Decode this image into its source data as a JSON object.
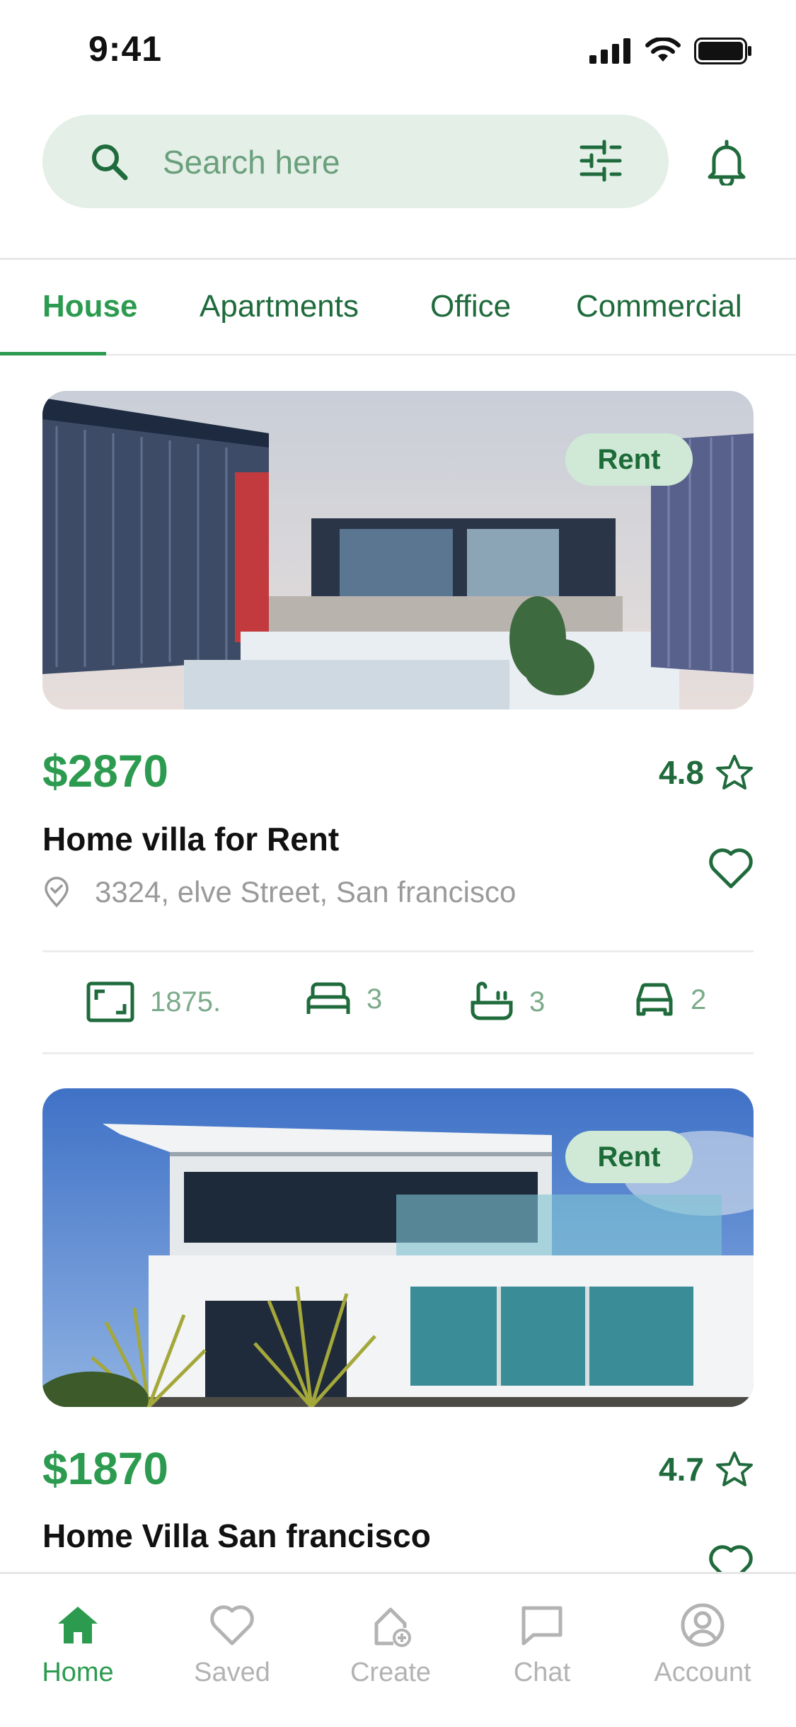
{
  "status_bar": {
    "time": "9:41"
  },
  "search": {
    "placeholder": "Search here"
  },
  "tabs": [
    {
      "label": "House",
      "active": true
    },
    {
      "label": "Apartments",
      "active": false
    },
    {
      "label": "Office",
      "active": false
    },
    {
      "label": "Commercial",
      "active": false
    }
  ],
  "listings": [
    {
      "badge": "Rent",
      "price": "$2870",
      "rating": "4.8",
      "title": "Home villa for Rent",
      "address": "3324, elve Street, San francisco",
      "features": {
        "area": "1875.",
        "beds": "3",
        "baths": "3",
        "garage": "2"
      }
    },
    {
      "badge": "Rent",
      "price": "$1870",
      "rating": "4.7",
      "title": "Home Villa San francisco"
    }
  ],
  "bottom_nav": [
    {
      "label": "Home",
      "icon": "home-icon",
      "active": true
    },
    {
      "label": "Saved",
      "icon": "heart-icon",
      "active": false
    },
    {
      "label": "Create",
      "icon": "add-home-icon",
      "active": false
    },
    {
      "label": "Chat",
      "icon": "chat-icon",
      "active": false
    },
    {
      "label": "Account",
      "icon": "account-icon",
      "active": false
    }
  ],
  "colors": {
    "accent": "#2c9b4f",
    "accent_dark": "#1f6b3c",
    "search_bg": "#e4efe7",
    "badge_bg": "#cfe9d6",
    "muted_text": "#9a9a9a",
    "inactive_nav": "#b3b3b3"
  }
}
